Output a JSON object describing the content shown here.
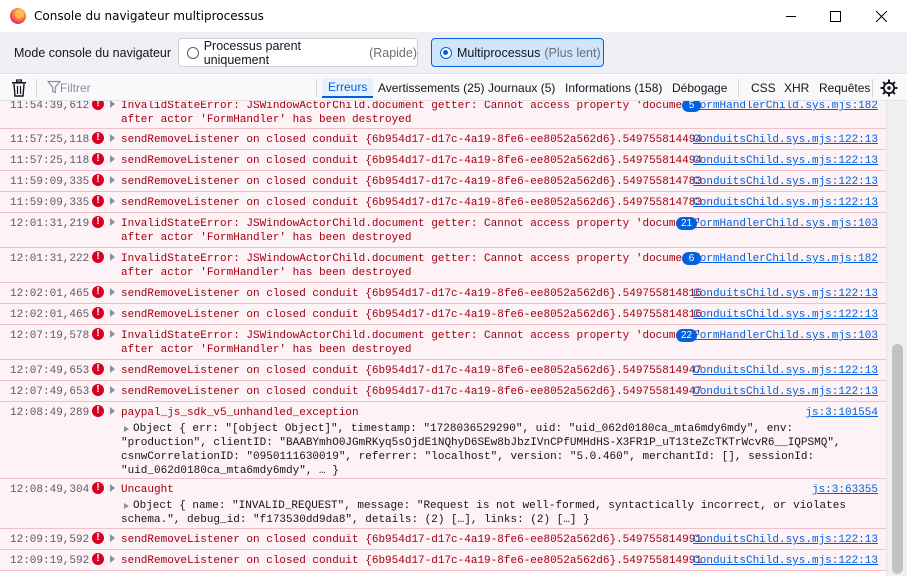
{
  "window": {
    "title": "Console du navigateur multiprocessus",
    "controls": {
      "minimize_icon": "minimize-icon",
      "maximize_icon": "maximize-icon",
      "close_icon": "close-icon"
    }
  },
  "mode": {
    "label": "Mode console du navigateur",
    "options": [
      {
        "label": "Processus parent uniquement",
        "hint": "(Rapide)",
        "selected": false
      },
      {
        "label": "Multiprocessus",
        "hint": "(Plus lent)",
        "selected": true
      }
    ]
  },
  "toolbar": {
    "filter_placeholder": "Filtrer",
    "chips": [
      "Erreurs",
      "Avertissements (25)",
      "Journaux (5)",
      "Informations (158)",
      "Débogage",
      "CSS",
      "XHR",
      "Requêtes"
    ],
    "active_chip": "Erreurs"
  },
  "colors": {
    "error_bg": "#fdf2f5",
    "error_text": "#a4000f",
    "accent": "#0061e0"
  },
  "log": [
    {
      "time": "11:54:39,612",
      "line1": "InvalidStateError: JSWindowActorChild.document getter: Cannot access property 'document'",
      "line2": "after actor 'FormHandler' has been destroyed",
      "badge": "5",
      "source": "FormHandlerChild.sys.mjs:182"
    },
    {
      "time": "11:57:25,118",
      "line1": "sendRemoveListener on closed conduit {6b954d17-d17c-4a19-8fe6-ee8052a562d6}.549755814494",
      "source": "ConduitsChild.sys.mjs:122:13"
    },
    {
      "time": "11:57:25,118",
      "line1": "sendRemoveListener on closed conduit {6b954d17-d17c-4a19-8fe6-ee8052a562d6}.549755814494",
      "source": "ConduitsChild.sys.mjs:122:13"
    },
    {
      "time": "11:59:09,335",
      "line1": "sendRemoveListener on closed conduit {6b954d17-d17c-4a19-8fe6-ee8052a562d6}.549755814783",
      "source": "ConduitsChild.sys.mjs:122:13"
    },
    {
      "time": "11:59:09,335",
      "line1": "sendRemoveListener on closed conduit {6b954d17-d17c-4a19-8fe6-ee8052a562d6}.549755814783",
      "source": "ConduitsChild.sys.mjs:122:13"
    },
    {
      "time": "12:01:31,219",
      "line1": "InvalidStateError: JSWindowActorChild.document getter: Cannot access property 'document'",
      "line2": "after actor 'FormHandler' has been destroyed",
      "badge": "21",
      "source": "FormHandlerChild.sys.mjs:103"
    },
    {
      "time": "12:01:31,222",
      "line1": "InvalidStateError: JSWindowActorChild.document getter: Cannot access property 'document'",
      "line2": "after actor 'FormHandler' has been destroyed",
      "badge": "6",
      "source": "FormHandlerChild.sys.mjs:182"
    },
    {
      "time": "12:02:01,465",
      "line1": "sendRemoveListener on closed conduit {6b954d17-d17c-4a19-8fe6-ee8052a562d6}.549755814816",
      "source": "ConduitsChild.sys.mjs:122:13"
    },
    {
      "time": "12:02:01,465",
      "line1": "sendRemoveListener on closed conduit {6b954d17-d17c-4a19-8fe6-ee8052a562d6}.549755814816",
      "source": "ConduitsChild.sys.mjs:122:13"
    },
    {
      "time": "12:07:19,578",
      "line1": "InvalidStateError: JSWindowActorChild.document getter: Cannot access property 'document'",
      "line2": "after actor 'FormHandler' has been destroyed",
      "badge": "22",
      "source": "FormHandlerChild.sys.mjs:103"
    },
    {
      "time": "12:07:49,653",
      "line1": "sendRemoveListener on closed conduit {6b954d17-d17c-4a19-8fe6-ee8052a562d6}.549755814947",
      "source": "ConduitsChild.sys.mjs:122:13"
    },
    {
      "time": "12:07:49,653",
      "line1": "sendRemoveListener on closed conduit {6b954d17-d17c-4a19-8fe6-ee8052a562d6}.549755814947",
      "source": "ConduitsChild.sys.mjs:122:13"
    },
    {
      "time": "12:08:49,289",
      "line1": "paypal_js_sdk_v5_unhandled_exception",
      "source": "js:3:101554",
      "object_lines": [
        "Object { err: \"[object Object]\", timestamp: \"1728036529290\", uid: \"uid_062d0180ca_mta6mdy6mdy\", env:",
        "\"production\", clientID: \"BAABYmhO0JGmRKyq5sOjdE1NQhyD6SEw8bJbzIVnCPfUMHdHS-X3FR1P_uT13teZcTKTrWcvR6__IQPSMQ\",",
        "csnwCorrelationID: \"0950111630019\", referrer: \"localhost\", version: \"5.0.460\", merchantId: [], sessionId:",
        "\"uid_062d0180ca_mta6mdy6mdy\", … }"
      ]
    },
    {
      "time": "12:08:49,304",
      "line1": "Uncaught",
      "source": "js:3:63355",
      "object_lines": [
        "Object { name: \"INVALID_REQUEST\", message: \"Request is not well-formed, syntactically incorrect, or violates",
        "schema.\", debug_id: \"f173530dd9da8\", details: (2) […], links: (2) […] }"
      ]
    },
    {
      "time": "12:09:19,592",
      "line1": "sendRemoveListener on closed conduit {6b954d17-d17c-4a19-8fe6-ee8052a562d6}.549755814991",
      "source": "ConduitsChild.sys.mjs:122:13"
    },
    {
      "time": "12:09:19,592",
      "line1": "sendRemoveListener on closed conduit {6b954d17-d17c-4a19-8fe6-ee8052a562d6}.549755814991",
      "source": "ConduitsChild.sys.mjs:122:13"
    }
  ]
}
